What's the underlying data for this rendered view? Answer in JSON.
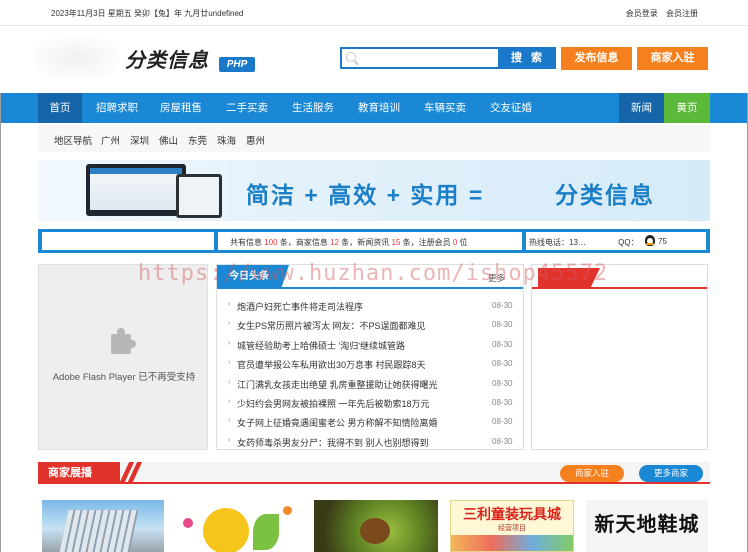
{
  "topbar": {
    "date": "2023年11月3日 星期五 癸卯【兔】年 九月廿undefined",
    "login": "会员登录",
    "register": "会员注册"
  },
  "header": {
    "logo_text": "分类信息",
    "logo_badge": "PHP",
    "search_placeholder": "",
    "search_button": "搜 索",
    "post_button": "发布信息",
    "merchant_button": "商家入驻"
  },
  "nav": {
    "items": [
      "首页",
      "招聘求职",
      "房屋租售",
      "二手买卖",
      "生活服务",
      "教育培训",
      "车辆买卖",
      "交友征婚"
    ],
    "news": "新闻",
    "yellow_pages": "黄页"
  },
  "region": {
    "label": "地区导航",
    "cities": [
      "广州",
      "深圳",
      "佛山",
      "东莞",
      "珠海",
      "惠州"
    ]
  },
  "banner": {
    "slogan": "简洁 + 高效 + 实用 =",
    "slogan_right": "分类信息"
  },
  "stats": {
    "prefix_info": "共有信息",
    "info_count": "100",
    "prefix_merchant": "条，商家信息",
    "merchant_count": "12",
    "prefix_news": "条，新闻资讯",
    "news_count": "15",
    "prefix_members": "条，注册会员",
    "member_count": "0",
    "suffix": "位",
    "phone_label": "热线电话：13…",
    "qq_label": "QQ：",
    "qq_value": "75"
  },
  "flash": {
    "message": "Adobe Flash Player 已不再受支持"
  },
  "news": {
    "tab": "今日头条",
    "more": "更多",
    "items": [
      {
        "title": "炮酒户妇死亡事件将走司法程序",
        "date": "08-30"
      },
      {
        "title": "女生PS常历照片被泻太 网友：不PS逞面都难见",
        "date": "08-30"
      },
      {
        "title": "城管经验助考上哈佛硕士 '淘归'继续城管路",
        "date": "08-30"
      },
      {
        "title": "官员遭举报公车私用欲出30万息事 村民跟踪8天",
        "date": "08-30"
      },
      {
        "title": "江门满乳女孩走出绝望 乳房重整援助让她获得曙光",
        "date": "08-30"
      },
      {
        "title": "少妇约会男网友被拍裸照 一年先后被勒索18万元",
        "date": "08-30"
      },
      {
        "title": "女子网上征婚竟遇闺蜜老公 男方称解不知情险离婚",
        "date": "08-30"
      },
      {
        "title": "女药师毒杀男友分尸：我得不到 别人也别想得到",
        "date": "08-30"
      }
    ]
  },
  "merchant": {
    "tab": "商家展播",
    "join": "商家入驻",
    "more": "更多商家",
    "toy_title": "三利童装玩具城",
    "toy_sub": "经营项目",
    "shoe_title": "新天地鞋城"
  },
  "watermark": "https://www.huzhan.com/ishop45572",
  "colors": {
    "primary_blue": "#1a88d4",
    "dark_blue": "#1565a8",
    "orange": "#f7801e",
    "red": "#e2322c",
    "green": "#5cb838"
  }
}
